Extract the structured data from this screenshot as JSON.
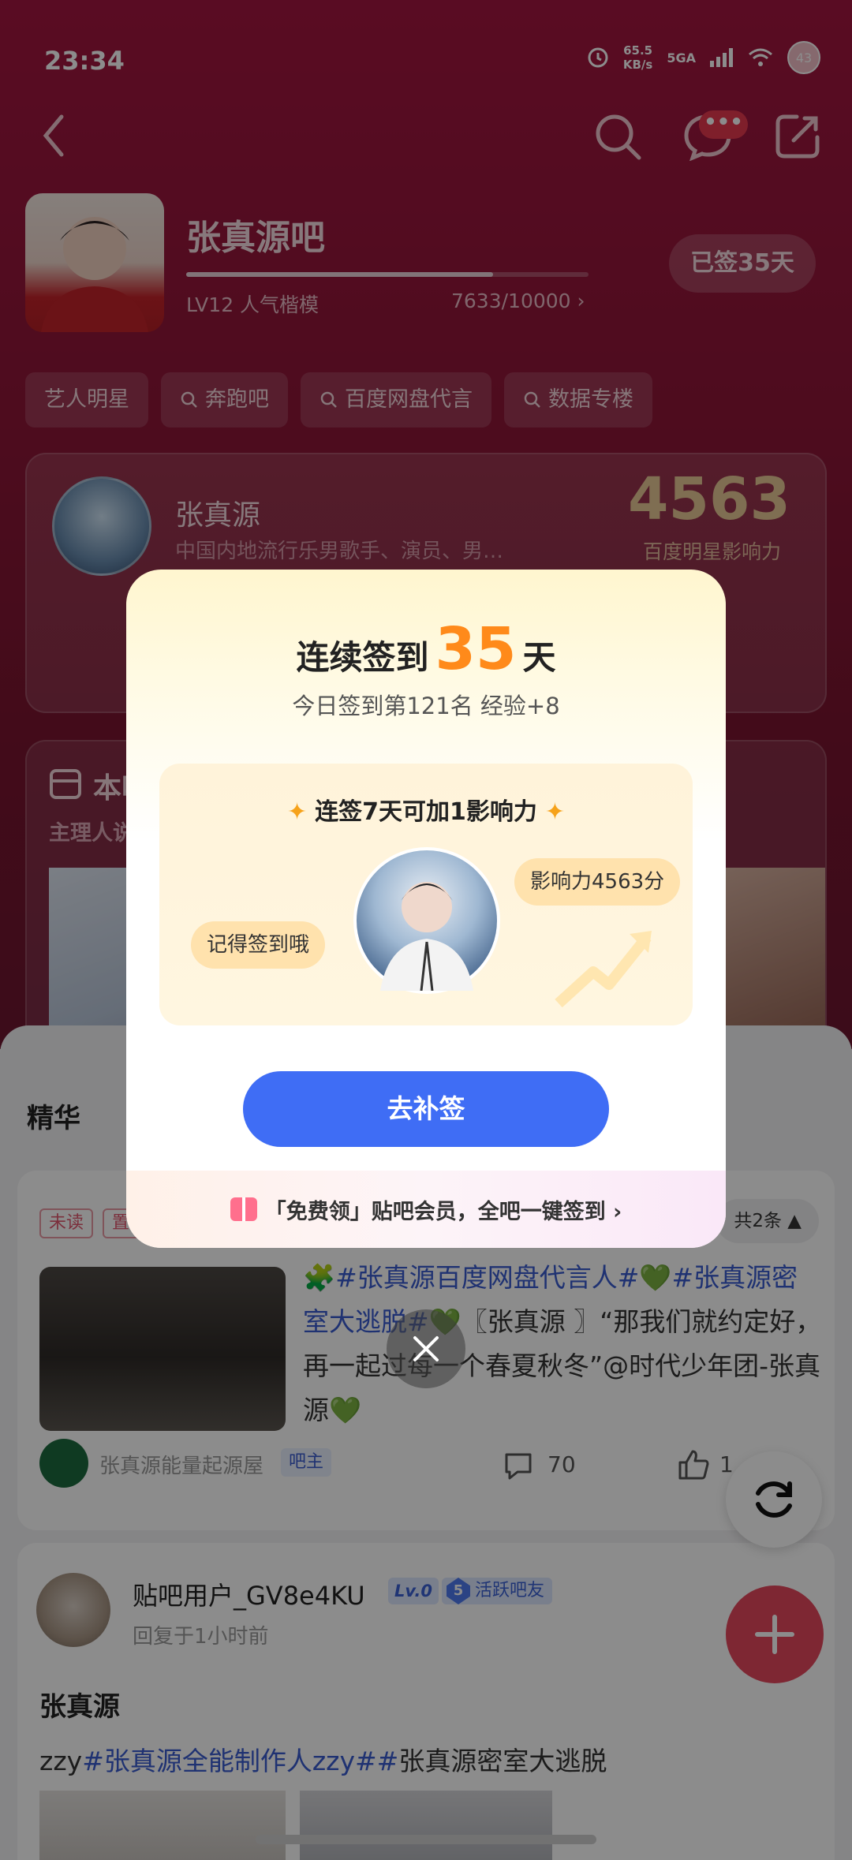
{
  "status_bar": {
    "time": "23:34",
    "speed_value": "65.5",
    "speed_unit": "KB/s",
    "network": "5GA",
    "battery": "43"
  },
  "forum": {
    "name": "张真源吧",
    "level": "LV12 人气楷模",
    "exp": "7633/10000 ›",
    "exp_progress": 0.7633,
    "signed_label": "已签35天"
  },
  "tags": [
    "艺人明星",
    "奔跑吧",
    "百度网盘代言",
    "数据专楼"
  ],
  "star": {
    "name": "张真源",
    "desc": "中国内地流行乐男歌手、演员、男…",
    "influence": "4563",
    "influence_label": "百度明星影响力"
  },
  "hot": {
    "title": "本吧",
    "subtitle": "主理人说"
  },
  "feed": {
    "section_title": "精华",
    "post1": {
      "badge_unread": "未读",
      "badge_top": "置顶",
      "count_label": "共2条",
      "text_tag1": "#张真源百度网盘代言人#",
      "text_tag2": "#张真源密室大逃脱#",
      "text_body": "〖张真源 〗“那我们就约定好，再一起过每一个春夏秋冬”@时代少年团-张真源",
      "author": "张真源能量起源屋",
      "author_badge": "吧主",
      "comments": "70",
      "likes": "1"
    },
    "post2": {
      "user": "贴吧用户_GV8e4KU",
      "level": "Lv.0",
      "active_num": "5",
      "active_label": "活跃吧友",
      "time": "回复于1小时前",
      "title": "张真源",
      "text_a": "zzy",
      "text_tag1": "#张真源全能制作人zzy#",
      "text_tag2": "张真源密室大逃脱"
    }
  },
  "modal": {
    "title_prefix": "连续签到",
    "days": "35",
    "title_suffix": "天",
    "subtitle": "今日签到第121名 经验+8",
    "promo_title": "连签7天可加1影响力",
    "bubble_left": "记得签到哦",
    "bubble_right": "影响力4563分",
    "button": "去补签",
    "footer": "「免费领」贴吧会员，全吧一键签到 ›"
  },
  "colors": {
    "accent_orange": "#ff8a1a",
    "button_blue": "#3f6df5",
    "hero_red": "#8e1738"
  }
}
